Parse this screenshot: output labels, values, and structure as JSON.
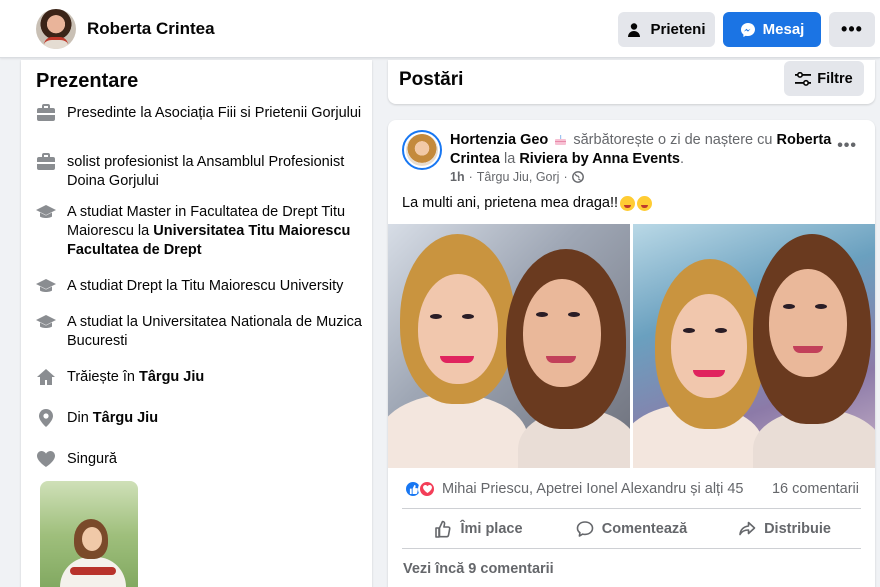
{
  "header": {
    "profile_name": "Roberta Crintea",
    "friends_label": "Prieteni",
    "message_label": "Mesaj",
    "more_label": "•••"
  },
  "intro": {
    "title": "Prezentare",
    "items": [
      {
        "icon": "briefcase-icon",
        "text": "Presedinte la Asociația Fiii si Prietenii Gorjului"
      },
      {
        "icon": "briefcase-icon",
        "text": "solist profesionist la Ansamblul Profesionist Doina Gorjului"
      },
      {
        "icon": "graduation-cap-icon",
        "prefix": "A studiat Master in Facultatea de Drept Titu Maiorescu la ",
        "bold": "Universitatea Titu Maiorescu Facultatea de Drept"
      },
      {
        "icon": "graduation-cap-icon",
        "text": "A studiat Drept la Titu Maiorescu University"
      },
      {
        "icon": "graduation-cap-icon",
        "text": "A studiat la Universitatea Nationala de Muzica Bucuresti"
      },
      {
        "icon": "home-icon",
        "prefix": "Trăiește în ",
        "bold": "Târgu Jiu"
      },
      {
        "icon": "location-pin-icon",
        "prefix": "Din ",
        "bold": "Târgu Jiu"
      },
      {
        "icon": "heart-icon",
        "text": "Singură"
      }
    ]
  },
  "posts": {
    "title": "Postări",
    "filter_label": "Filtre"
  },
  "post": {
    "author": "Hortenzia Geo",
    "action_text": "sărbătorește o zi de naștere cu",
    "tagged": "Roberta Crintea",
    "at_word": "la",
    "place": "Riviera by Anna Events",
    "time": "1h",
    "location": "Târgu Jiu, Gorj",
    "separator": "·",
    "text": "La multi ani, prietena mea draga!!",
    "more_label": "•••",
    "reactions_names": "Mihai Priescu, Apetrei Ionel Alexandru și alți 45",
    "comments_count": "16 comentarii",
    "like_label": "Îmi place",
    "comment_label": "Comentează",
    "share_label": "Distribuie",
    "view_more_comments": "Vezi încă 9 comentarii"
  },
  "colors": {
    "accent": "#1b74e4",
    "page_bg": "#f0f2f5",
    "secondary_text": "#65676b",
    "love_reaction": "#f33e58"
  }
}
